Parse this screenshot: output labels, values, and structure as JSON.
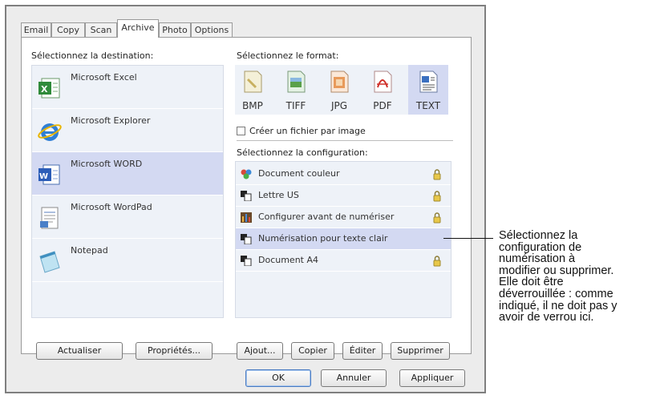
{
  "tabs": [
    {
      "label": "Email"
    },
    {
      "label": "Copy"
    },
    {
      "label": "Scan"
    },
    {
      "label": "Archive",
      "active": true
    },
    {
      "label": "Photo"
    },
    {
      "label": "Options"
    }
  ],
  "destination": {
    "heading": "Sélectionnez la destination:",
    "items": [
      {
        "label": "Microsoft Excel",
        "icon": "excel-icon"
      },
      {
        "label": "Microsoft Explorer",
        "icon": "internet-explorer-icon"
      },
      {
        "label": "Microsoft WORD",
        "icon": "word-icon",
        "selected": true
      },
      {
        "label": "Microsoft WordPad",
        "icon": "wordpad-icon"
      },
      {
        "label": "Notepad",
        "icon": "notepad-icon"
      }
    ]
  },
  "format": {
    "heading": "Sélectionnez le format:",
    "items": [
      {
        "label": "BMP",
        "icon": "bmp-file-icon"
      },
      {
        "label": "TIFF",
        "icon": "tiff-file-icon"
      },
      {
        "label": "JPG",
        "icon": "jpg-file-icon"
      },
      {
        "label": "PDF",
        "icon": "pdf-file-icon"
      },
      {
        "label": "TEXT",
        "icon": "text-file-icon",
        "selected": true
      }
    ],
    "per_image_checkbox": "Créer un fichier par image",
    "per_image_checked": false
  },
  "configuration": {
    "heading": "Sélectionnez la configuration:",
    "items": [
      {
        "label": "Document couleur",
        "icon": "color-document-icon",
        "locked": true
      },
      {
        "label": "Lettre US",
        "icon": "document-icon",
        "locked": true
      },
      {
        "label": "Configurer avant de numériser",
        "icon": "configure-icon",
        "locked": true
      },
      {
        "label": "Numérisation pour texte clair",
        "icon": "document-icon",
        "locked": false,
        "selected": true
      },
      {
        "label": "Document A4",
        "icon": "document-icon",
        "locked": true
      }
    ]
  },
  "buttons": {
    "refresh": "Actualiser",
    "properties": "Propriétés...",
    "add": "Ajout...",
    "copy": "Copier",
    "edit": "Éditer",
    "delete": "Supprimer",
    "ok": "OK",
    "cancel": "Annuler",
    "apply": "Appliquer"
  },
  "annotation": "Sélectionnez la\nconfiguration de\nnumérisation à\nmodifier ou supprimer.\nElle doit être\ndéverrouillée : comme\nindiqué, il ne doit pas y\navoir de verrou ici.",
  "colors": {
    "list_bg": "#eef2f8",
    "selection": "#d3d9f2",
    "default_button_border": "#4a7bc1"
  }
}
